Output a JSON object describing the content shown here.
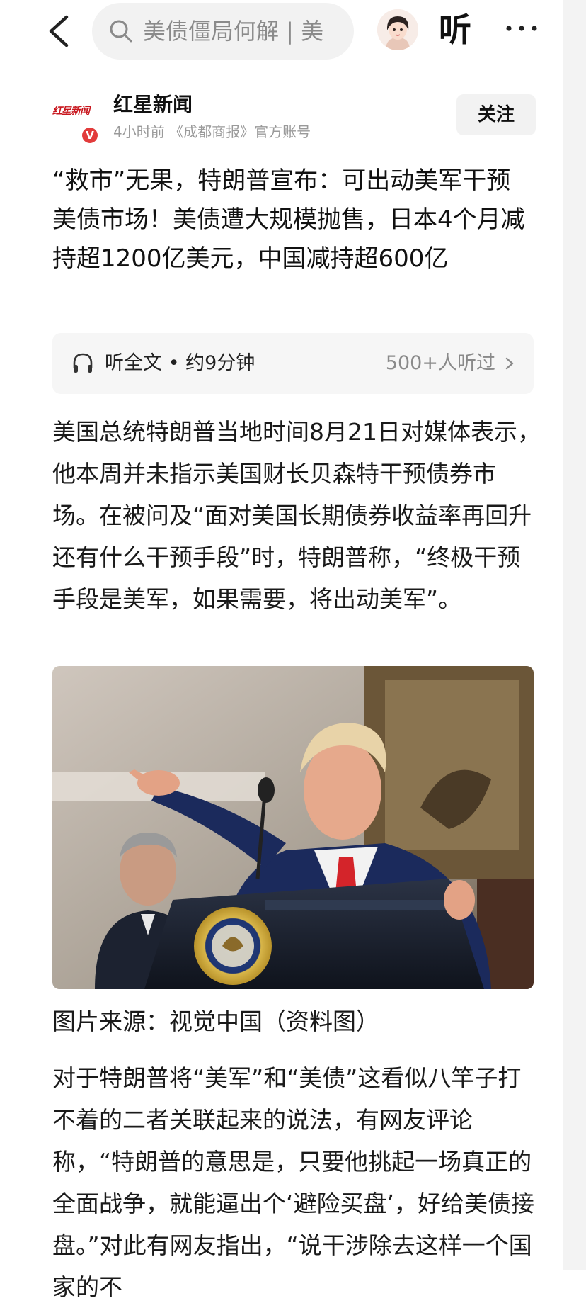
{
  "search": {
    "placeholder_text": "美债僵局何解 | 美"
  },
  "nav": {
    "listen_label": "听"
  },
  "account": {
    "logo_text": "红星新闻",
    "verified_mark": "V",
    "name": "红星新闻",
    "meta": "4小时前 《成都商报》官方账号",
    "follow_label": "关注"
  },
  "article": {
    "headline": "“救市”无果，特朗普宣布：可出动美军干预美债市场！美债遭大规模抛售，日本4个月减持超1200亿美元，中国减持超600亿",
    "audio_label": "听全文 • 约9分钟",
    "audio_count": "500+人听过",
    "paragraph_1": "美国总统特朗普当地时间8月21日对媒体表示，他本周并未指示美国财长贝森特干预债券市场。在被问及“面对美国长期债券收益率再回升还有什么干预手段”时，特朗普称，“终极干预手段是美军，如果需要，将出动美军”。",
    "photo_caption": "图片来源：视觉中国（资料图）",
    "paragraph_2": "对于特朗普将“美军”和“美债”这看似八竿子打不着的二者关联起来的说法，有网友评论称，“特朗普的意思是，只要他挑起一场真正的全面战争，就能逼出个‘避险买盘’，好给美债接盘。”对此有网友指出，“说干涉除去这样一个国家的不"
  },
  "colors": {
    "accent_red": "#e32b2b",
    "text_primary": "#1a1a1a",
    "text_secondary": "#9a9a9a",
    "surface_gray": "#f2f2f2"
  },
  "icons": {
    "back": "chevron-left-icon",
    "search": "search-icon",
    "more": "more-horizontal-icon",
    "audio": "headphones-icon",
    "audio_chevron": "chevron-right-icon"
  }
}
